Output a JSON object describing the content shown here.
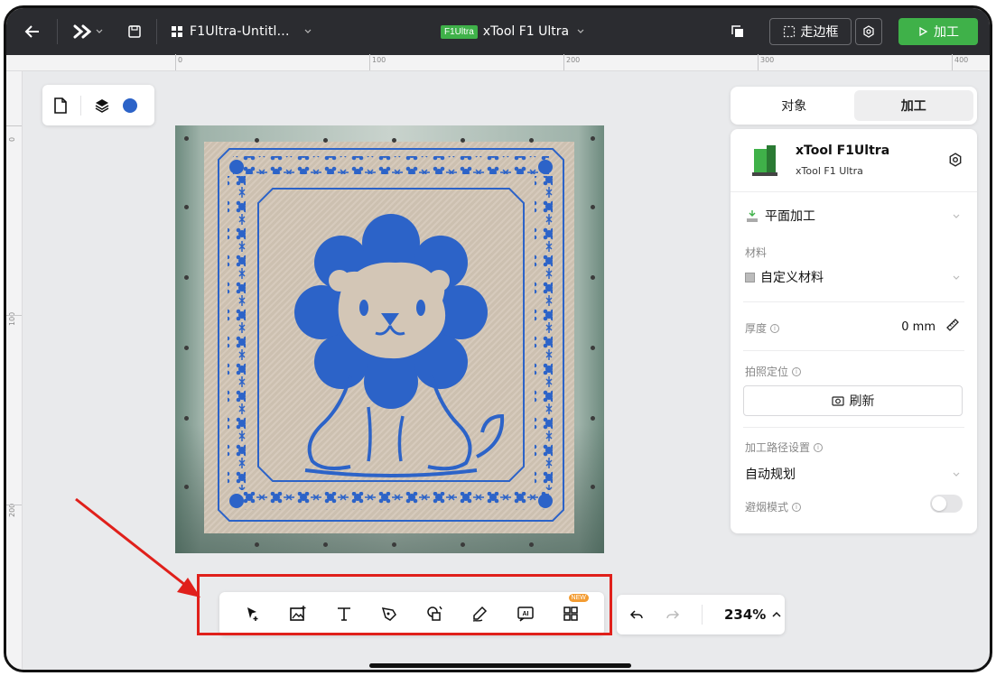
{
  "topbar": {
    "file_name": "F1Ultra-Untitl...",
    "device_chip": "F1Ultra",
    "device_name": "xTool F1 Ultra",
    "frame_label": "走边框",
    "process_label": "加工"
  },
  "ruler": {
    "top_marks": [
      "0",
      "100",
      "200",
      "300",
      "400"
    ],
    "left_marks": [
      "0",
      "100",
      "200"
    ]
  },
  "right_panel": {
    "tabs": [
      {
        "label": "对象",
        "active": false
      },
      {
        "label": "加工",
        "active": true
      }
    ],
    "device_title": "xTool F1Ultra",
    "device_subtitle": "xTool F1 Ultra",
    "mode_label": "平面加工",
    "material_label": "材料",
    "material_value": "自定义材料",
    "thickness_label": "厚度",
    "thickness_value": "0 mm",
    "camera_label": "拍照定位",
    "refresh_label": "刷新",
    "path_label": "加工路径设置",
    "path_value": "自动规划",
    "smoke_label": "避烟模式",
    "smoke_enabled": false
  },
  "bottom_toolbar": {
    "new_badge": "NEW",
    "zoom": "234%"
  },
  "colors": {
    "accent_green": "#3fb149",
    "art_blue": "#2c63c8",
    "highlight_red": "#e0201b"
  }
}
